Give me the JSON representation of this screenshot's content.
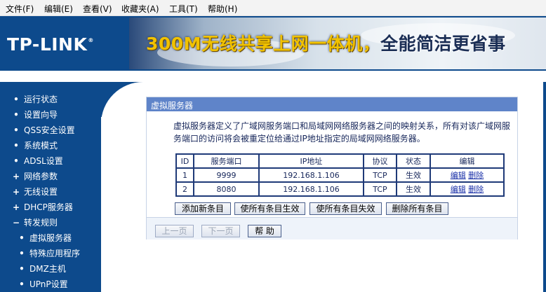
{
  "menubar": [
    "文件(F)",
    "编辑(E)",
    "查看(V)",
    "收藏夹(A)",
    "工具(T)",
    "帮助(H)"
  ],
  "header": {
    "logo": "TP-LINK",
    "logo_mark": "®",
    "slogan_part1": "300M无线共享上网一体机，",
    "slogan_part2": "全能简洁更省事"
  },
  "sidebar": {
    "items": [
      {
        "bullet": "•",
        "label": "运行状态"
      },
      {
        "bullet": "•",
        "label": "设置向导"
      },
      {
        "bullet": "•",
        "label": "QSS安全设置"
      },
      {
        "bullet": "•",
        "label": "系统模式"
      },
      {
        "bullet": "•",
        "label": "ADSL设置"
      },
      {
        "bullet": "+",
        "label": "网络参数"
      },
      {
        "bullet": "+",
        "label": "无线设置"
      },
      {
        "bullet": "+",
        "label": "DHCP服务器"
      },
      {
        "bullet": "−",
        "label": "转发规则"
      },
      {
        "bullet": "•",
        "label": "虚拟服务器"
      },
      {
        "bullet": "•",
        "label": "特殊应用程序"
      },
      {
        "bullet": "•",
        "label": "DMZ主机"
      },
      {
        "bullet": "•",
        "label": "UPnP设置"
      }
    ]
  },
  "panel": {
    "title": "虚拟服务器",
    "description": "虚拟服务器定义了广域网服务端口和局域网网络服务器之间的映射关系，所有对该广域网服务端口的访问将会被重定位给通过IP地址指定的局域网网络服务器。",
    "table": {
      "headers": [
        "ID",
        "服务端口",
        "IP地址",
        "协议",
        "状态",
        "编辑"
      ],
      "rows": [
        {
          "id": "1",
          "port": "9999",
          "ip": "192.168.1.106",
          "protocol": "TCP",
          "status": "生效",
          "edit": "编辑",
          "delete": "删除"
        },
        {
          "id": "2",
          "port": "8080",
          "ip": "192.168.1.106",
          "protocol": "TCP",
          "status": "生效",
          "edit": "编辑",
          "delete": "删除"
        }
      ]
    },
    "buttons": {
      "add": "添加新条目",
      "enable_all": "使所有条目生效",
      "disable_all": "使所有条目失效",
      "delete_all": "删除所有条目"
    },
    "footer": {
      "prev": "上一页",
      "next": "下一页",
      "help": "帮 助"
    }
  }
}
